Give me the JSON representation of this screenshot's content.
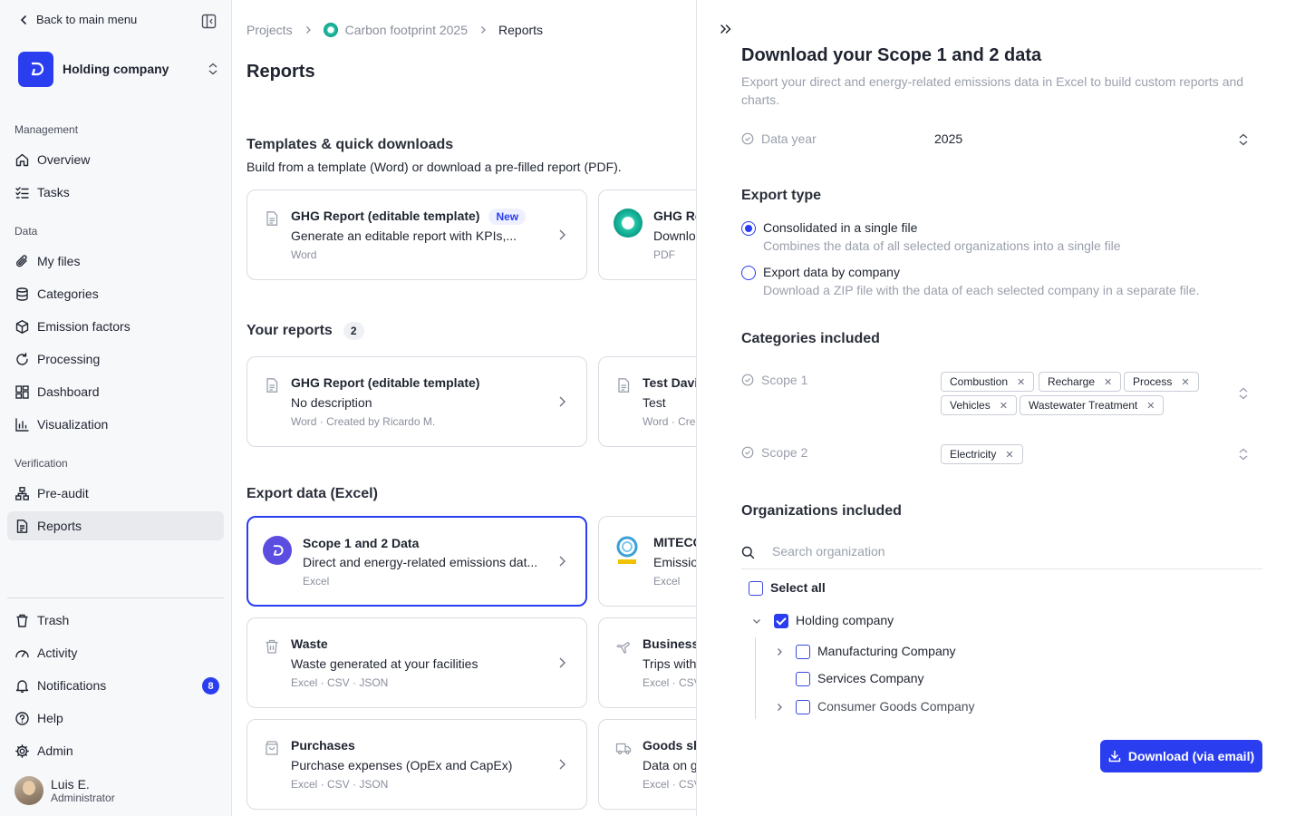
{
  "sidebar": {
    "back_label": "Back to main menu",
    "org_name": "Holding company",
    "sections": {
      "management": "Management",
      "data": "Data",
      "verification": "Verification"
    },
    "items": {
      "overview": "Overview",
      "tasks": "Tasks",
      "my_files": "My files",
      "categories": "Categories",
      "emission_factors": "Emission factors",
      "processing": "Processing",
      "dashboard": "Dashboard",
      "visualization": "Visualization",
      "pre_audit": "Pre-audit",
      "reports": "Reports",
      "trash": "Trash",
      "activity": "Activity",
      "notifications": "Notifications",
      "help": "Help",
      "admin": "Admin"
    },
    "notifications_count": "8",
    "user": {
      "name": "Luis E.",
      "role": "Administrator"
    }
  },
  "main": {
    "breadcrumb": {
      "projects": "Projects",
      "project": "Carbon footprint 2025",
      "current": "Reports"
    },
    "title": "Reports",
    "templates": {
      "heading": "Templates & quick downloads",
      "subtitle": "Build from a template (Word) or download a pre-filled report (PDF).",
      "cards": [
        {
          "title": "GHG Report (editable template)",
          "badge": "New",
          "desc": "Generate an editable report with KPIs,...",
          "meta": "Word"
        },
        {
          "title": "GHG Re",
          "desc": "Downlo",
          "meta": "PDF"
        }
      ]
    },
    "reports": {
      "heading": "Your reports",
      "count": "2",
      "cards": [
        {
          "title": "GHG Report (editable template)",
          "desc": "No description",
          "meta": "Word · Created by Ricardo M."
        },
        {
          "title": "Test Davi",
          "desc": "Test",
          "meta": "Word · Cre"
        }
      ]
    },
    "export": {
      "heading": "Export data (Excel)",
      "cards": [
        {
          "title": "Scope 1 and 2 Data",
          "desc": "Direct and energy-related emissions dat...",
          "meta": "Excel"
        },
        {
          "title": "MITECO",
          "desc": "Emissio",
          "meta": "Excel"
        },
        {
          "title": "Waste",
          "desc": "Waste generated at your facilities",
          "meta": "Excel · CSV · JSON"
        },
        {
          "title": "Business",
          "desc": "Trips with",
          "meta": "Excel · CSV"
        },
        {
          "title": "Purchases",
          "desc": "Purchase expenses (OpEx and CapEx)",
          "meta": "Excel · CSV · JSON"
        },
        {
          "title": "Goods sh",
          "desc": "Data on g",
          "meta": "Excel · CSV"
        }
      ]
    }
  },
  "panel": {
    "title": "Download your Scope 1 and 2 data",
    "description": "Export your direct and energy-related emissions data in Excel to build custom reports and charts.",
    "data_year_label": "Data year",
    "data_year_value": "2025",
    "export_type": {
      "heading": "Export type",
      "options": [
        {
          "label": "Consolidated in a single file",
          "desc": "Combines the data of all selected organizations into a single file",
          "selected": true
        },
        {
          "label": "Export data by company",
          "desc": "Download a ZIP file with the data of each selected company in a separate file.",
          "selected": false
        }
      ]
    },
    "categories": {
      "heading": "Categories included",
      "scope1_label": "Scope 1",
      "scope1_chips": [
        "Combustion",
        "Recharge",
        "Process",
        "Vehicles",
        "Wastewater Treatment"
      ],
      "scope2_label": "Scope 2",
      "scope2_chips": [
        "Electricity"
      ]
    },
    "organizations": {
      "heading": "Organizations included",
      "search_placeholder": "Search organization",
      "select_all": "Select all",
      "root": "Holding company",
      "children": [
        "Manufacturing Company",
        "Services Company",
        "Consumer Goods Company"
      ]
    },
    "download_label": "Download (via email)"
  },
  "colors": {
    "accent": "#2a3ef0",
    "sidebar_bg": "#f7f8fa",
    "muted_text": "#9aa0ac"
  }
}
